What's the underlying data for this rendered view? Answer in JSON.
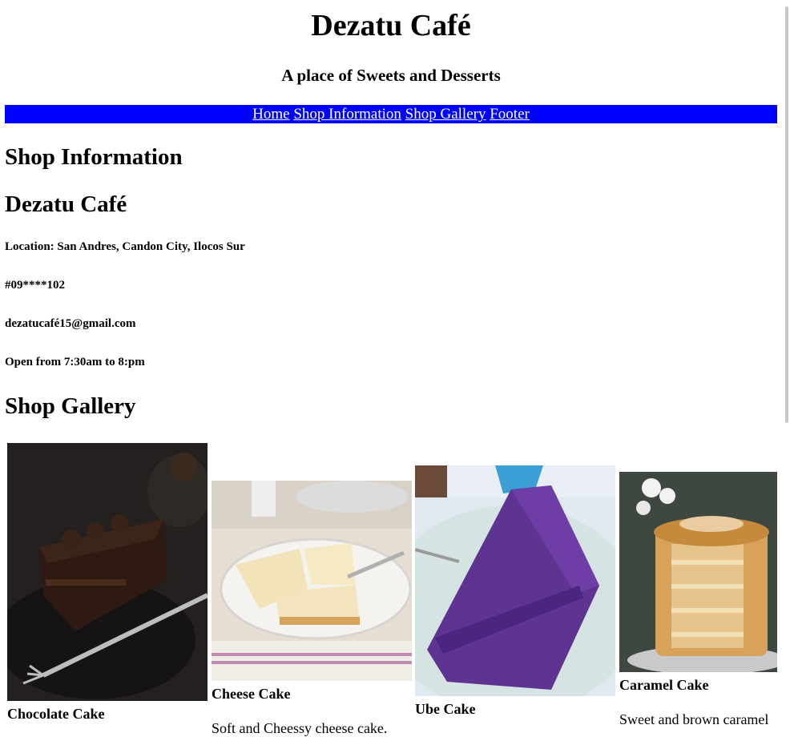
{
  "header": {
    "title": "Dezatu Café",
    "tagline": "A place of Sweets and Desserts"
  },
  "nav": {
    "items": [
      {
        "label": "Home"
      },
      {
        "label": "Shop Information"
      },
      {
        "label": "Shop Gallery"
      },
      {
        "label": "Footer"
      }
    ]
  },
  "shop_info": {
    "heading": "Shop Information",
    "name": "Dezatu Café",
    "location": "Location: San Andres, Candon City, Ilocos Sur",
    "phone": "#09****102",
    "email": "dezatucafé15@gmail.com",
    "hours": "Open from 7:30am to 8:pm"
  },
  "gallery": {
    "heading": "Shop Gallery",
    "items": [
      {
        "caption": "Chocolate Cake",
        "description": ""
      },
      {
        "caption": "Cheese Cake",
        "description": "Soft and Cheessy cheese cake."
      },
      {
        "caption": "Ube Cake",
        "description": ""
      },
      {
        "caption": "Caramel Cake",
        "description": "Sweet and brown caramel"
      }
    ]
  },
  "colors": {
    "nav_background": "#0000ff",
    "nav_link": "#ffffff"
  }
}
